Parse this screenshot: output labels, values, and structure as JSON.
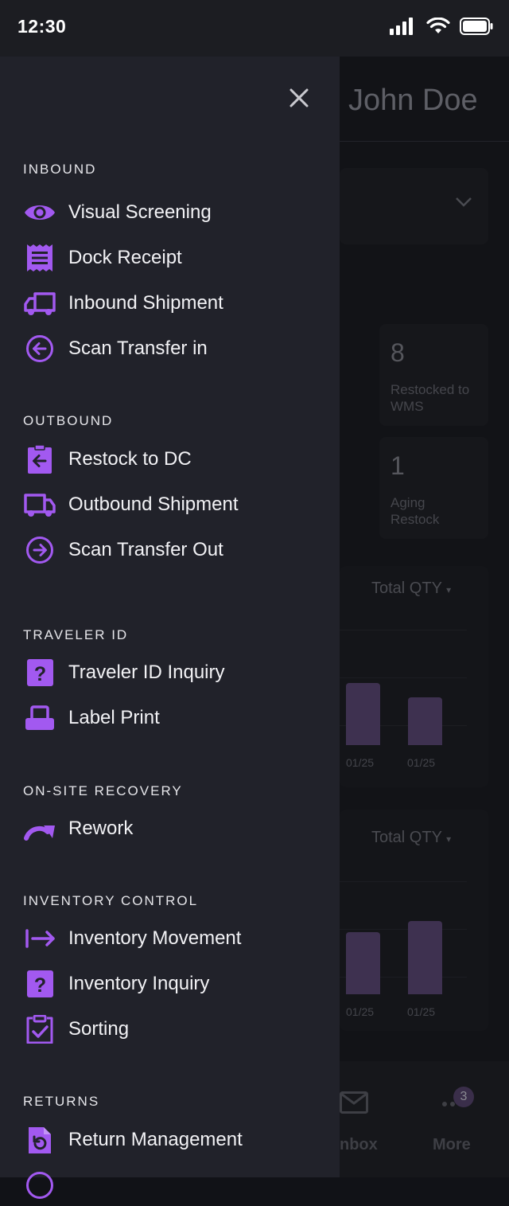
{
  "status_bar": {
    "time": "12:30"
  },
  "background": {
    "user_name": "John Doe",
    "stats": [
      {
        "value": "8",
        "label_line1": "Restocked to",
        "label_line2": "WMS"
      },
      {
        "value": "1",
        "label_line1": "Aging",
        "label_line2": "Restock"
      }
    ],
    "charts": [
      {
        "selector": "Total QTY",
        "dates": [
          "01/25",
          "01/25"
        ]
      },
      {
        "selector": "Total QTY",
        "dates": [
          "01/25",
          "01/25"
        ]
      }
    ],
    "bottom_nav": {
      "inbox_label": "nbox",
      "more_label": "More",
      "badge_count": "3"
    }
  },
  "drawer": {
    "sections": [
      {
        "title": "INBOUND",
        "items": [
          {
            "label": "Visual Screening",
            "icon": "eye-icon"
          },
          {
            "label": "Dock Receipt",
            "icon": "receipt-icon"
          },
          {
            "label": "Inbound Shipment",
            "icon": "truck-icon"
          },
          {
            "label": "Scan Transfer in",
            "icon": "arrow-circle-left-icon"
          }
        ]
      },
      {
        "title": "OUTBOUND",
        "items": [
          {
            "label": "Restock to DC",
            "icon": "clipboard-arrow-icon"
          },
          {
            "label": "Outbound Shipment",
            "icon": "truck-outline-icon"
          },
          {
            "label": "Scan Transfer Out",
            "icon": "arrow-circle-right-icon"
          }
        ]
      },
      {
        "title": "TRAVELER ID",
        "items": [
          {
            "label": "Traveler ID Inquiry",
            "icon": "question-square-icon"
          },
          {
            "label": "Label Print",
            "icon": "printer-icon"
          }
        ]
      },
      {
        "title": "ON-SITE RECOVERY",
        "items": [
          {
            "label": "Rework",
            "icon": "redo-arrow-icon"
          }
        ]
      },
      {
        "title": "INVENTORY CONTROL",
        "items": [
          {
            "label": "Inventory Movement",
            "icon": "arrow-to-right-icon"
          },
          {
            "label": "Inventory Inquiry",
            "icon": "question-square-icon"
          },
          {
            "label": "Sorting",
            "icon": "clipboard-check-icon"
          }
        ]
      },
      {
        "title": "RETURNS",
        "items": [
          {
            "label": "Return Management",
            "icon": "file-return-icon"
          }
        ]
      }
    ]
  },
  "colors": {
    "accent": "#a259f0",
    "drawer_bg": "#21222a",
    "status_bg": "#1c1d22"
  }
}
